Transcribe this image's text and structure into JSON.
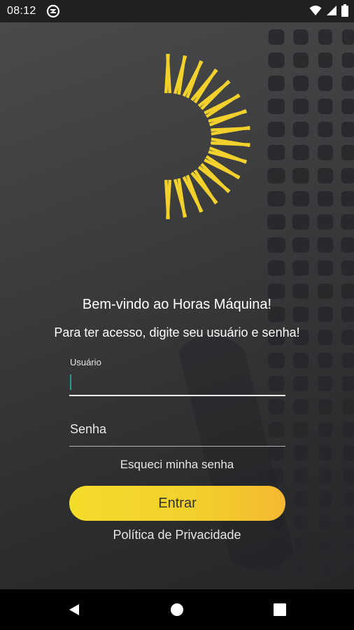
{
  "status_bar": {
    "time": "08:12",
    "icons": [
      "app-notification-icon",
      "wifi-icon",
      "signal-icon",
      "battery-icon"
    ]
  },
  "app": {
    "logo": "yellow-sunburst-logo"
  },
  "login": {
    "welcome_title": "Bem-vindo ao Horas Máquina!",
    "welcome_subtitle": "Para ter acesso, digite seu usuário e senha!",
    "username_label": "Usuário",
    "username_value": "",
    "password_label": "Senha",
    "forgot_password": "Esqueci minha senha",
    "submit_label": "Entrar",
    "privacy_policy": "Política de Privacidade"
  },
  "nav_bar": {
    "icons": [
      "back-icon",
      "home-icon",
      "recents-icon"
    ]
  },
  "colors": {
    "accent_yellow": "#f2d12c",
    "background_dark": "#2b2c2e",
    "cursor_teal": "#17a589",
    "text_white": "#ffffff"
  }
}
